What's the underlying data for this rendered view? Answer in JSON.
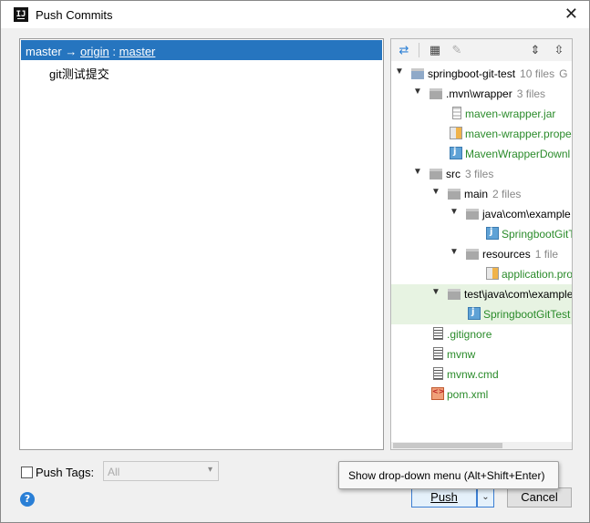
{
  "window": {
    "title": "Push Commits",
    "app_icon_text": "IJ",
    "close_glyph": "✕"
  },
  "commits": {
    "branch_local": "master",
    "arrow": "→",
    "remote": "origin",
    "separator": ":",
    "branch_remote": "master",
    "message": "git测试提交"
  },
  "toolbar": {
    "icons": [
      "expand-diff-icon",
      "group-by-icon",
      "edit-icon",
      "expand-all-icon",
      "collapse-all-icon"
    ]
  },
  "tree": {
    "root": {
      "label": "springboot-git-test",
      "count": "10 files",
      "suffix": "G"
    },
    "mvn": {
      "label": ".mvn\\wrapper",
      "count": "3 files"
    },
    "mvn_files": [
      "maven-wrapper.jar",
      "maven-wrapper.prope",
      "MavenWrapperDownl"
    ],
    "src": {
      "label": "src",
      "count": "3 files"
    },
    "main": {
      "label": "main",
      "count": "2 files"
    },
    "java_main": {
      "label": "java\\com\\example"
    },
    "java_main_file": "SpringbootGitT",
    "resources": {
      "label": "resources",
      "count": "1 file"
    },
    "resources_file": "application.pro",
    "test_java": {
      "label": "test\\java\\com\\example"
    },
    "test_file": "SpringbootGitTest",
    "root_files": [
      ".gitignore",
      "mvnw",
      "mvnw.cmd",
      "pom.xml"
    ]
  },
  "bottom": {
    "push_tags_label": "Push Tags:",
    "push_tags_checked": false,
    "tags_select_value": "All",
    "help_glyph": "?",
    "push_label": "Push",
    "dropdown_glyph": "⌄",
    "cancel_label": "Cancel"
  },
  "tooltip": {
    "text": "Show drop-down menu (Alt+Shift+Enter)"
  },
  "colors": {
    "selection": "#2675bf",
    "added_file": "#2a8b2a",
    "highlight_row": "#e7f3e2",
    "default_button_border": "#3c7fd4"
  }
}
